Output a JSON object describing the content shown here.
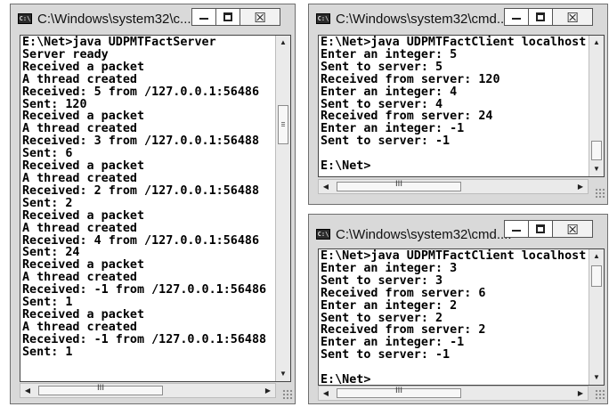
{
  "icon_text": "C:\\",
  "server_window": {
    "title": "C:\\Windows\\system32\\c...",
    "lines": [
      "E:\\Net>java UDPMTFactServer",
      "Server ready",
      "Received a packet",
      "A thread created",
      "Received: 5 from /127.0.0.1:56486",
      "Sent: 120",
      "Received a packet",
      "A thread created",
      "Received: 3 from /127.0.0.1:56488",
      "Sent: 6",
      "Received a packet",
      "A thread created",
      "Received: 2 from /127.0.0.1:56488",
      "Sent: 2",
      "Received a packet",
      "A thread created",
      "Received: 4 from /127.0.0.1:56486",
      "Sent: 24",
      "Received a packet",
      "A thread created",
      "Received: -1 from /127.0.0.1:56486",
      "Sent: 1",
      "Received a packet",
      "A thread created",
      "Received: -1 from /127.0.0.1:56488",
      "Sent: 1"
    ]
  },
  "client_window_1": {
    "title": "C:\\Windows\\system32\\cmd....",
    "lines": [
      "E:\\Net>java UDPMTFactClient localhost",
      "Enter an integer: 5",
      "Sent to server: 5",
      "Received from server: 120",
      "Enter an integer: 4",
      "Sent to server: 4",
      "Received from server: 24",
      "Enter an integer: -1",
      "Sent to server: -1",
      "",
      "E:\\Net>"
    ]
  },
  "client_window_2": {
    "title": "C:\\Windows\\system32\\cmd....",
    "lines": [
      "E:\\Net>java UDPMTFactClient localhost",
      "Enter an integer: 3",
      "Sent to server: 3",
      "Received from server: 6",
      "Enter an integer: 2",
      "Sent to server: 2",
      "Received from server: 2",
      "Enter an integer: -1",
      "Sent to server: -1",
      "",
      "E:\\Net>"
    ]
  },
  "scroll_thumb_grip": "III",
  "buttons": {
    "close_glyph": "☒"
  }
}
